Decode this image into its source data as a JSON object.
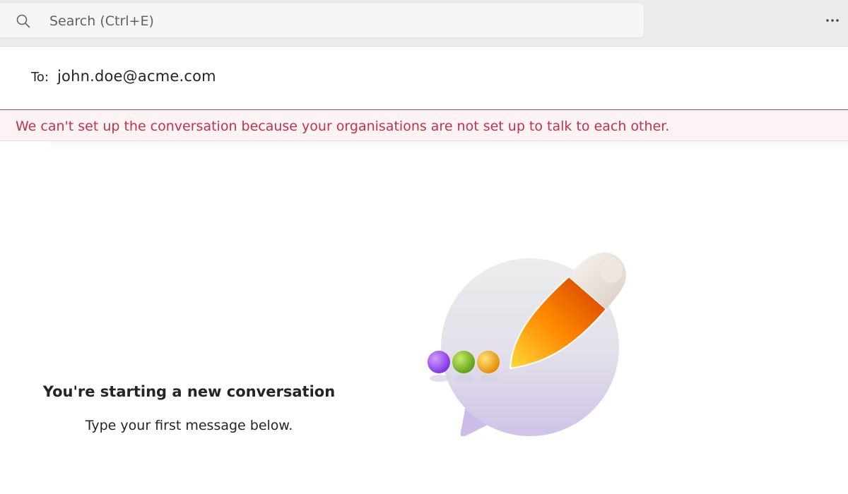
{
  "search": {
    "placeholder": "Search (Ctrl+E)",
    "icon": "search-icon"
  },
  "header": {
    "more_icon": "more-options-icon"
  },
  "compose": {
    "to_label": "To:",
    "to_value": "john.doe@acme.com"
  },
  "error": {
    "message": "We can't set up the conversation because your organisations are not set up to talk to each other.",
    "color": "#c4314b"
  },
  "empty_state": {
    "title": "You're starting a new conversation",
    "subtitle": "Type your first message below.",
    "illustration": "chat-bubble-pen-illustration"
  },
  "colors": {
    "accent": "#8b4f7f",
    "error_background": "#fdf3f4"
  }
}
